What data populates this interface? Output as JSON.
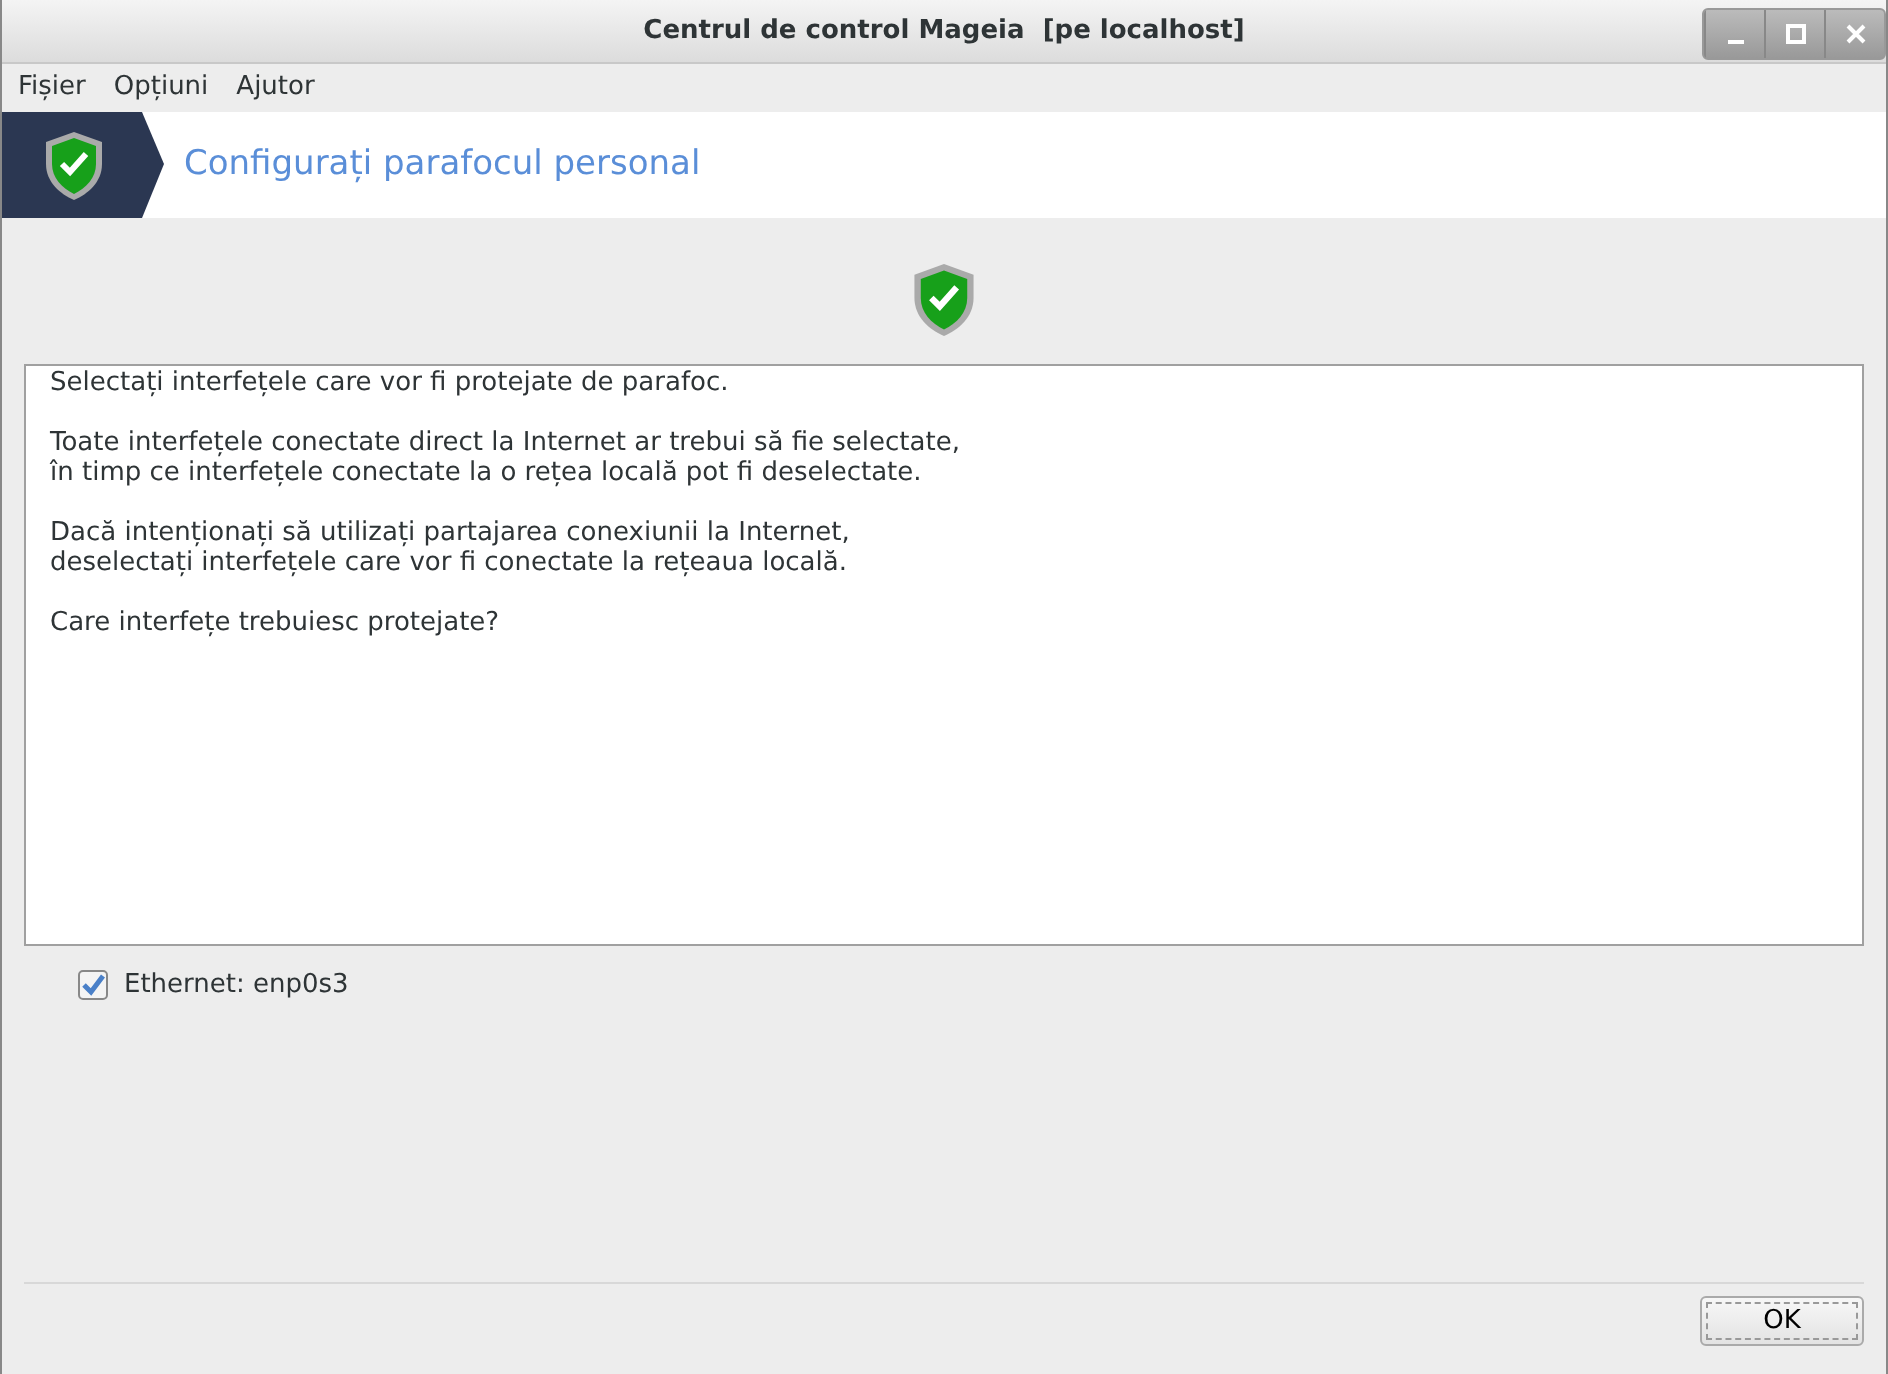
{
  "window": {
    "title": "Centrul de control Mageia  [pe localhost]"
  },
  "menu": [
    "Fișier",
    "Opțiuni",
    "Ajutor"
  ],
  "header": {
    "title": "Configurați parafocul personal"
  },
  "message": [
    "Selectați interfețele care vor fi protejate de parafoc.",
    "Toate interfețele conectate direct la Internet ar trebui să fie selectate,\nîn timp ce interfețele conectate la o rețea locală pot fi deselectate.",
    "Dacă intenționați să utilizați partajarea conexiunii la Internet,\ndeselectați interfețele care vor fi conectate la rețeaua locală.",
    "Care interfețe trebuiesc protejate?"
  ],
  "interfaces": [
    {
      "label": "Ethernet: enp0s3",
      "checked": true
    }
  ],
  "buttons": [
    "OK"
  ]
}
